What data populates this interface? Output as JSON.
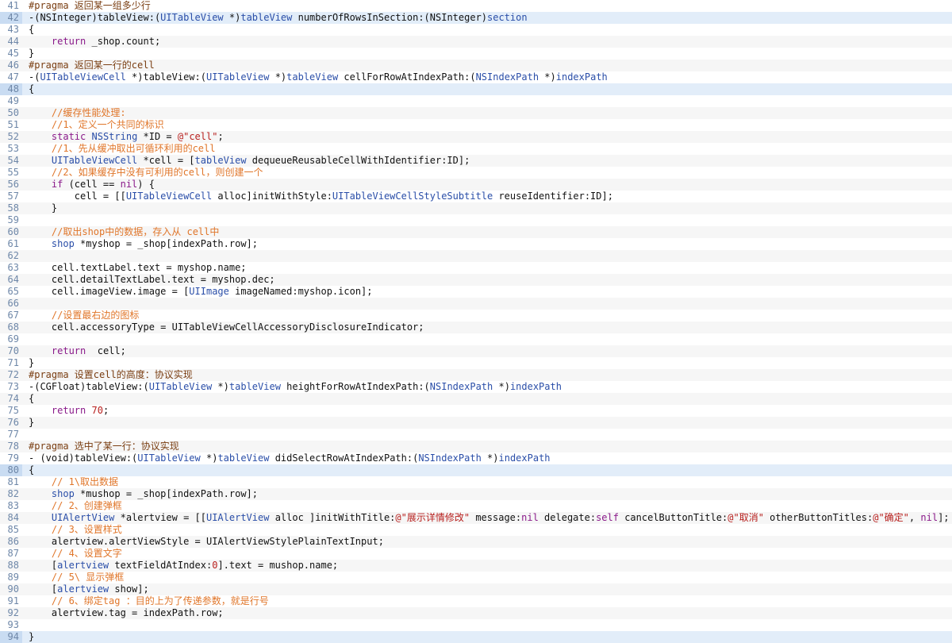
{
  "colors": {
    "gutter_text": "#6e87a8",
    "plain": "#111111",
    "keyword": "#8a1a8a",
    "type": "#2a4ea8",
    "comment": "#e0762a",
    "string": "#b8201e",
    "pragma": "#7a3e12",
    "row_alt": "#f6f6f6",
    "selected_row": "#e2edf9"
  },
  "lines": [
    {
      "n": "41",
      "tokens": [
        [
          "pragma",
          "#pragma"
        ],
        [
          "pragmatext",
          " 返回某一组多少行"
        ]
      ]
    },
    {
      "n": "42",
      "tokens": [
        [
          "plain",
          "-(NSInteger)tableView:("
        ],
        [
          "type",
          "UITableView"
        ],
        [
          "plain",
          " *)"
        ],
        [
          "method",
          "tableView"
        ],
        [
          "plain",
          " numberOfRowsInSection:(NSInteger)"
        ],
        [
          "method",
          "section"
        ]
      ]
    },
    {
      "n": "43",
      "tokens": [
        [
          "plain",
          "{"
        ]
      ]
    },
    {
      "n": "44",
      "tokens": [
        [
          "plain",
          "    "
        ],
        [
          "kw",
          "return"
        ],
        [
          "plain",
          " _shop.count;"
        ]
      ]
    },
    {
      "n": "45",
      "tokens": [
        [
          "plain",
          "}"
        ]
      ]
    },
    {
      "n": "46",
      "tokens": [
        [
          "pragma",
          "#pragma"
        ],
        [
          "pragmatext",
          " 返回某一行的cell"
        ]
      ]
    },
    {
      "n": "47",
      "tokens": [
        [
          "plain",
          "-("
        ],
        [
          "type",
          "UITableViewCell"
        ],
        [
          "plain",
          " *)tableView:("
        ],
        [
          "type",
          "UITableView"
        ],
        [
          "plain",
          " *)"
        ],
        [
          "method",
          "tableView"
        ],
        [
          "plain",
          " cellForRowAtIndexPath:("
        ],
        [
          "type",
          "NSIndexPath"
        ],
        [
          "plain",
          " *)"
        ],
        [
          "method",
          "indexPath"
        ]
      ]
    },
    {
      "n": "48",
      "tokens": [
        [
          "plain",
          "{"
        ]
      ]
    },
    {
      "n": "49",
      "tokens": [
        [
          "plain",
          ""
        ]
      ]
    },
    {
      "n": "50",
      "tokens": [
        [
          "plain",
          "    "
        ],
        [
          "comment",
          "//缓存性能处理:"
        ]
      ]
    },
    {
      "n": "51",
      "tokens": [
        [
          "plain",
          "    "
        ],
        [
          "comment",
          "//1、定义一个共同的标识"
        ]
      ]
    },
    {
      "n": "52",
      "tokens": [
        [
          "plain",
          "    "
        ],
        [
          "kw",
          "static"
        ],
        [
          "plain",
          " "
        ],
        [
          "type",
          "NSString"
        ],
        [
          "plain",
          " *ID = "
        ],
        [
          "string",
          "@\"cell\""
        ],
        [
          "plain",
          ";"
        ]
      ]
    },
    {
      "n": "53",
      "tokens": [
        [
          "plain",
          "    "
        ],
        [
          "comment",
          "//1、先从缓冲取出可循环利用的cell"
        ]
      ]
    },
    {
      "n": "54",
      "tokens": [
        [
          "plain",
          "    "
        ],
        [
          "type",
          "UITableViewCell"
        ],
        [
          "plain",
          " *cell = ["
        ],
        [
          "method",
          "tableView"
        ],
        [
          "plain",
          " dequeueReusableCellWithIdentifier:ID];"
        ]
      ]
    },
    {
      "n": "55",
      "tokens": [
        [
          "plain",
          "    "
        ],
        [
          "comment",
          "//2、如果缓存中没有可利用的cell，则创建一个"
        ]
      ]
    },
    {
      "n": "56",
      "tokens": [
        [
          "plain",
          "    "
        ],
        [
          "kw",
          "if"
        ],
        [
          "plain",
          " (cell == "
        ],
        [
          "kw",
          "nil"
        ],
        [
          "plain",
          ") {"
        ]
      ]
    },
    {
      "n": "57",
      "tokens": [
        [
          "plain",
          "        cell = [["
        ],
        [
          "type",
          "UITableViewCell"
        ],
        [
          "plain",
          " alloc]initWithStyle:"
        ],
        [
          "type",
          "UITableViewCellStyleSubtitle"
        ],
        [
          "plain",
          " reuseIdentifier:ID];"
        ]
      ]
    },
    {
      "n": "58",
      "tokens": [
        [
          "plain",
          "    }"
        ]
      ]
    },
    {
      "n": "59",
      "tokens": [
        [
          "plain",
          ""
        ]
      ]
    },
    {
      "n": "60",
      "tokens": [
        [
          "plain",
          "    "
        ],
        [
          "comment",
          "//取出shop中的数据，存入从 cell中"
        ]
      ]
    },
    {
      "n": "61",
      "tokens": [
        [
          "plain",
          "    "
        ],
        [
          "type",
          "shop"
        ],
        [
          "plain",
          " *myshop = _shop[indexPath.row];"
        ]
      ]
    },
    {
      "n": "62",
      "tokens": [
        [
          "plain",
          ""
        ]
      ]
    },
    {
      "n": "63",
      "tokens": [
        [
          "plain",
          "    cell.textLabel.text = myshop.name;"
        ]
      ]
    },
    {
      "n": "64",
      "tokens": [
        [
          "plain",
          "    cell.detailTextLabel.text = myshop.dec;"
        ]
      ]
    },
    {
      "n": "65",
      "tokens": [
        [
          "plain",
          "    cell.imageView.image = ["
        ],
        [
          "type",
          "UIImage"
        ],
        [
          "plain",
          " imageNamed:myshop.icon];"
        ]
      ]
    },
    {
      "n": "66",
      "tokens": [
        [
          "plain",
          ""
        ]
      ]
    },
    {
      "n": "67",
      "tokens": [
        [
          "plain",
          "    "
        ],
        [
          "comment",
          "//设置最右边的图标"
        ]
      ]
    },
    {
      "n": "68",
      "tokens": [
        [
          "plain",
          "    cell.accessoryType = UITableViewCellAccessoryDisclosureIndicator;"
        ]
      ]
    },
    {
      "n": "69",
      "tokens": [
        [
          "plain",
          ""
        ]
      ]
    },
    {
      "n": "70",
      "tokens": [
        [
          "plain",
          "    "
        ],
        [
          "kw",
          "return"
        ],
        [
          "plain",
          "  cell;"
        ]
      ]
    },
    {
      "n": "71",
      "tokens": [
        [
          "plain",
          "}"
        ]
      ]
    },
    {
      "n": "72",
      "tokens": [
        [
          "pragma",
          "#pragma"
        ],
        [
          "pragmatext",
          " 设置cell的高度：协议实现"
        ]
      ]
    },
    {
      "n": "73",
      "tokens": [
        [
          "plain",
          "-(CGFloat)tableView:("
        ],
        [
          "type",
          "UITableView"
        ],
        [
          "plain",
          " *)"
        ],
        [
          "method",
          "tableView"
        ],
        [
          "plain",
          " heightForRowAtIndexPath:("
        ],
        [
          "type",
          "NSIndexPath"
        ],
        [
          "plain",
          " *)"
        ],
        [
          "method",
          "indexPath"
        ]
      ]
    },
    {
      "n": "74",
      "tokens": [
        [
          "plain",
          "{"
        ]
      ]
    },
    {
      "n": "75",
      "tokens": [
        [
          "plain",
          "    "
        ],
        [
          "kw",
          "return"
        ],
        [
          "plain",
          " "
        ],
        [
          "number",
          "70"
        ],
        [
          "plain",
          ";"
        ]
      ]
    },
    {
      "n": "76",
      "tokens": [
        [
          "plain",
          "}"
        ]
      ]
    },
    {
      "n": "77",
      "tokens": [
        [
          "plain",
          ""
        ]
      ]
    },
    {
      "n": "78",
      "tokens": [
        [
          "pragma",
          "#pragma"
        ],
        [
          "pragmatext",
          " 选中了某一行：协议实现"
        ]
      ]
    },
    {
      "n": "79",
      "tokens": [
        [
          "plain",
          "- (void)tableView:("
        ],
        [
          "type",
          "UITableView"
        ],
        [
          "plain",
          " *)"
        ],
        [
          "method",
          "tableView"
        ],
        [
          "plain",
          " didSelectRowAtIndexPath:("
        ],
        [
          "type",
          "NSIndexPath"
        ],
        [
          "plain",
          " *)"
        ],
        [
          "method",
          "indexPath"
        ]
      ]
    },
    {
      "n": "80",
      "tokens": [
        [
          "plain",
          "{"
        ]
      ]
    },
    {
      "n": "81",
      "tokens": [
        [
          "plain",
          "    "
        ],
        [
          "comment",
          "// 1\\取出数据"
        ]
      ]
    },
    {
      "n": "82",
      "tokens": [
        [
          "plain",
          "    "
        ],
        [
          "type",
          "shop"
        ],
        [
          "plain",
          " *mushop = _shop[indexPath.row];"
        ]
      ]
    },
    {
      "n": "83",
      "tokens": [
        [
          "plain",
          "    "
        ],
        [
          "comment",
          "// 2、创建弹框"
        ]
      ]
    },
    {
      "n": "84",
      "tokens": [
        [
          "plain",
          "    "
        ],
        [
          "type",
          "UIAlertView"
        ],
        [
          "plain",
          " *alertview = [["
        ],
        [
          "type",
          "UIAlertView"
        ],
        [
          "plain",
          " alloc ]initWithTitle:"
        ],
        [
          "string",
          "@\"展示详情修改\""
        ],
        [
          "plain",
          " message:"
        ],
        [
          "kw",
          "nil"
        ],
        [
          "plain",
          " delegate:"
        ],
        [
          "kw",
          "self"
        ],
        [
          "plain",
          " cancelButtonTitle:"
        ],
        [
          "string",
          "@\"取消\""
        ],
        [
          "plain",
          " otherButtonTitles:"
        ],
        [
          "string",
          "@\"确定\""
        ],
        [
          "plain",
          ", "
        ],
        [
          "kw",
          "nil"
        ],
        [
          "plain",
          "];"
        ]
      ]
    },
    {
      "n": "85",
      "tokens": [
        [
          "plain",
          "    "
        ],
        [
          "comment",
          "// 3、设置样式"
        ]
      ]
    },
    {
      "n": "86",
      "tokens": [
        [
          "plain",
          "    alertview.alertViewStyle = UIAlertViewStylePlainTextInput;"
        ]
      ]
    },
    {
      "n": "87",
      "tokens": [
        [
          "plain",
          "    "
        ],
        [
          "comment",
          "// 4、设置文字"
        ]
      ]
    },
    {
      "n": "88",
      "tokens": [
        [
          "plain",
          "    ["
        ],
        [
          "method",
          "alertview"
        ],
        [
          "plain",
          " textFieldAtIndex:"
        ],
        [
          "number",
          "0"
        ],
        [
          "plain",
          "].text = mushop.name;"
        ]
      ]
    },
    {
      "n": "89",
      "tokens": [
        [
          "plain",
          "    "
        ],
        [
          "comment",
          "// 5\\ 显示弹框"
        ]
      ]
    },
    {
      "n": "90",
      "tokens": [
        [
          "plain",
          "    ["
        ],
        [
          "method",
          "alertview"
        ],
        [
          "plain",
          " show];"
        ]
      ]
    },
    {
      "n": "91",
      "tokens": [
        [
          "plain",
          "    "
        ],
        [
          "comment",
          "// 6、绑定tag ：目的上为了传递参数，就是行号"
        ]
      ]
    },
    {
      "n": "92",
      "tokens": [
        [
          "plain",
          "    alertview.tag = indexPath.row;"
        ]
      ]
    },
    {
      "n": "93",
      "tokens": [
        [
          "plain",
          ""
        ]
      ]
    },
    {
      "n": "94",
      "tokens": [
        [
          "plain",
          "}"
        ]
      ]
    }
  ],
  "selected_lines": [
    "42",
    "48",
    "80",
    "94"
  ]
}
